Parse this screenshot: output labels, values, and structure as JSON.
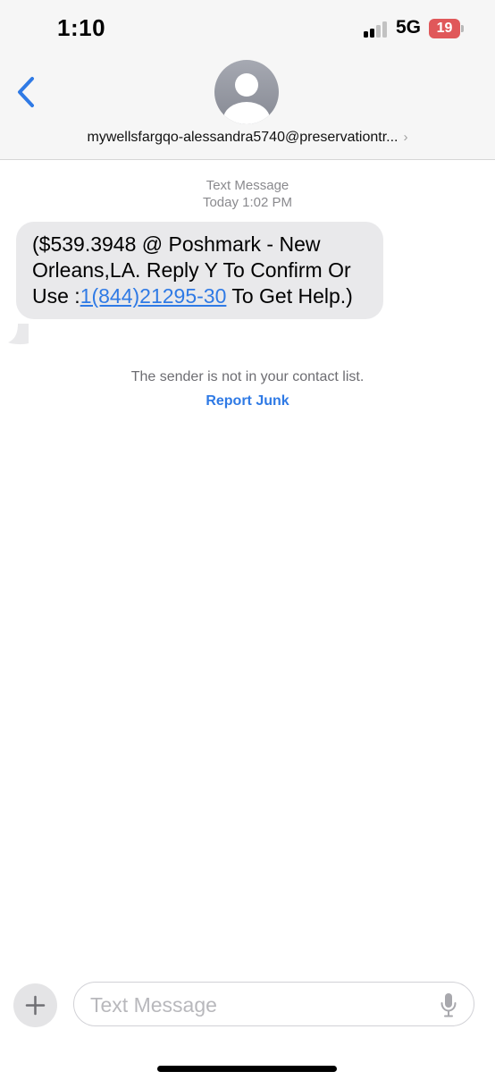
{
  "status_bar": {
    "time": "1:10",
    "network": "5G",
    "battery": "19"
  },
  "icons": {
    "back": "chevron-left-icon",
    "avatar": "person-silhouette-icon",
    "chevron": "chevron-right-icon",
    "plus": "plus-icon",
    "mic": "microphone-icon"
  },
  "colors": {
    "accent": "#2f7ae5",
    "bubble": "#e9e9eb",
    "battery_low": "#e0585a"
  },
  "conversation": {
    "sender": "mywellsfargqo-alessandra5740@preservationtr...",
    "chevron": "›"
  },
  "message": {
    "service": "Text Message",
    "timestamp": "Today 1:02 PM",
    "text_before": "($539.3948 @ Poshmark - New Orleans,LA. Reply Y To Confirm Or Use :",
    "link": "1(844)21295-30",
    "text_after": " To Get Help.)"
  },
  "notice": {
    "text": "The sender is not in your contact list.",
    "action": "Report Junk"
  },
  "compose": {
    "placeholder": "Text Message"
  }
}
